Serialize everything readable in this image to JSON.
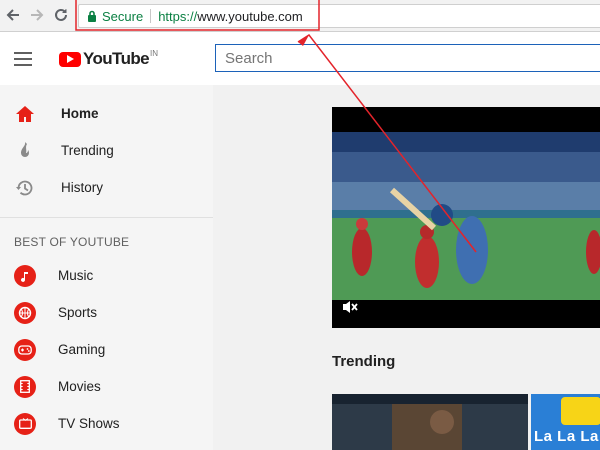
{
  "browser": {
    "secure_label": "Secure",
    "url_scheme": "https://",
    "url_host": "www.youtube.com",
    "icons": [
      "back-icon",
      "forward-icon",
      "reload-icon",
      "lock-icon"
    ]
  },
  "header": {
    "logo_text": "YouTube",
    "logo_region": "IN",
    "search_placeholder": "Search"
  },
  "sidebar": {
    "main_items": [
      {
        "label": "Home",
        "icon": "home-icon",
        "active": true
      },
      {
        "label": "Trending",
        "icon": "flame-icon",
        "active": false
      },
      {
        "label": "History",
        "icon": "history-icon",
        "active": false
      }
    ],
    "section_title": "BEST OF YOUTUBE",
    "best_items": [
      {
        "label": "Music",
        "icon": "music-icon"
      },
      {
        "label": "Sports",
        "icon": "sports-icon"
      },
      {
        "label": "Gaming",
        "icon": "gamepad-icon"
      },
      {
        "label": "Movies",
        "icon": "film-icon"
      },
      {
        "label": "TV Shows",
        "icon": "tv-icon"
      }
    ]
  },
  "main": {
    "trending_title": "Trending",
    "thumb2_text": "La La La"
  },
  "colors": {
    "brand_red": "#ff0000",
    "icon_red": "#e62117",
    "secure_green": "#0b8043",
    "annotation_red": "#e3242b",
    "search_focus_blue": "#1c62b9"
  }
}
